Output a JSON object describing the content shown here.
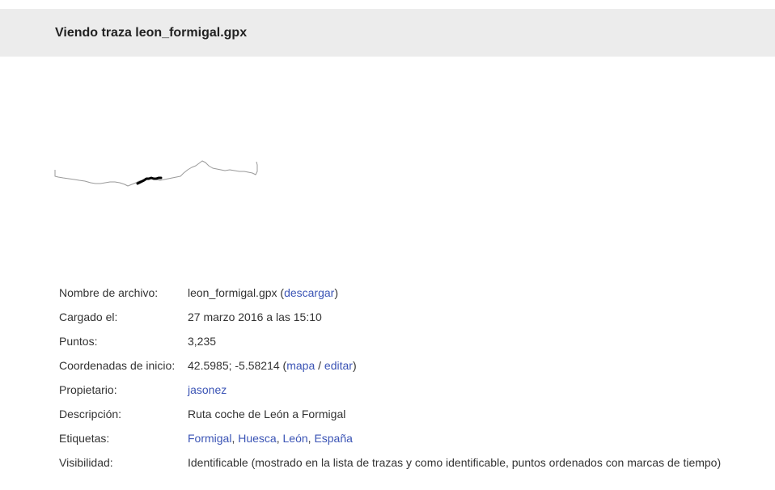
{
  "header": {
    "title": "Viendo traza leon_formigal.gpx"
  },
  "colors": {
    "header_bg": "#ececec",
    "link": "#3b54b5",
    "trace_full": "#9a9a9a",
    "trace_highlight": "#000000"
  },
  "details": {
    "filename": {
      "label": "Nombre de archivo:",
      "value": "leon_formigal.gpx",
      "open_paren": " (",
      "download_link": "descargar",
      "close_paren": ")"
    },
    "uploaded": {
      "label": "Cargado el:",
      "value": "27 marzo 2016 a las 15:10"
    },
    "points": {
      "label": "Puntos:",
      "value": "3,235"
    },
    "start_coords": {
      "label": "Coordenadas de inicio:",
      "value": "42.5985; -5.58214",
      "open_paren": " (",
      "map_link": "mapa",
      "separator": " / ",
      "edit_link": "editar",
      "close_paren": ")"
    },
    "owner": {
      "label": "Propietario:",
      "value": "jasonez"
    },
    "description": {
      "label": "Descripción:",
      "value": "Ruta coche de León a Formigal"
    },
    "tags": {
      "label": "Etiquetas:",
      "items": [
        "Formigal",
        "Huesca",
        "León",
        "España"
      ],
      "separator": ", "
    },
    "visibility": {
      "label": "Visibilidad:",
      "value": "Identificable (mostrado en la lista de trazas y como identificable, puntos ordenados con marcas de tiempo)"
    }
  }
}
